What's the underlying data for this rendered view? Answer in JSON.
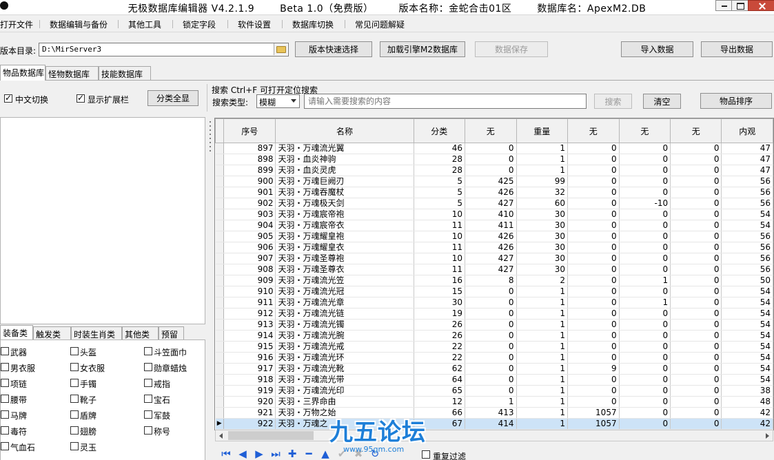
{
  "window": {
    "title_parts": [
      "无极数据库编辑器 V4.2.1.9",
      "Beta 1.0（免费版）",
      "版本名称：金蛇合击01区",
      "数据库名：ApexM2.DB"
    ]
  },
  "menu": [
    "打开文件",
    "数据编辑与备份",
    "其他工具",
    "锁定字段",
    "软件设置",
    "数据库切换",
    "常见问题解疑"
  ],
  "toolbar": {
    "dir_label": "版本目录:",
    "dir_value": "D:\\MirServer3",
    "quick_select": "版本快速选择",
    "load_engine": "加载引擎M2数据库",
    "save_data": "数据保存",
    "import_data": "导入数据",
    "export_data": "导出数据"
  },
  "tabs": [
    "物品数据库",
    "怪物数据库",
    "技能数据库"
  ],
  "options": {
    "chinese_switch": "中文切换",
    "show_ext": "显示扩展栏",
    "show_all_categories": "分类全显"
  },
  "search": {
    "hint": "搜索   Ctrl+F 可打开定位搜索",
    "type_label": "搜索类型:",
    "type_value": "模糊",
    "placeholder": "请输入需要搜索的内容",
    "search_button": "搜索",
    "clear_button": "清空",
    "sort_button": "物品排序"
  },
  "category_tabs": [
    "装备类",
    "触发类",
    "时装生肖类",
    "其他类",
    "预留"
  ],
  "categories": [
    [
      "武器",
      "头盔",
      "斗笠面巾"
    ],
    [
      "男衣服",
      "女衣服",
      "勋章蜡烛"
    ],
    [
      "项链",
      "手镯",
      "戒指"
    ],
    [
      "腰带",
      "靴子",
      "宝石"
    ],
    [
      "马牌",
      "盾牌",
      "军鼓"
    ],
    [
      "毒符",
      "翅膀",
      "称号"
    ],
    [
      "气血石",
      "灵玉",
      ""
    ]
  ],
  "grid": {
    "columns": [
      "序号",
      "名称",
      "分类",
      "无",
      "重量",
      "无",
      "无",
      "无",
      "内观"
    ],
    "rows": [
      [
        "897",
        "天羽・万魂流光翼",
        "46",
        "0",
        "1",
        "0",
        "0",
        "0",
        "47"
      ],
      [
        "898",
        "天羽・血炎神驹",
        "28",
        "0",
        "1",
        "0",
        "0",
        "0",
        "47"
      ],
      [
        "899",
        "天羽・血炎灵虎",
        "28",
        "0",
        "1",
        "0",
        "0",
        "0",
        "47"
      ],
      [
        "900",
        "天羽・万魂巨阙刃",
        "5",
        "425",
        "99",
        "0",
        "0",
        "0",
        "56"
      ],
      [
        "901",
        "天羽・万魂吞魔杖",
        "5",
        "426",
        "32",
        "0",
        "0",
        "0",
        "56"
      ],
      [
        "902",
        "天羽・万魂极天剑",
        "5",
        "427",
        "60",
        "0",
        "-10",
        "0",
        "56"
      ],
      [
        "903",
        "天羽・万魂宸帝袍",
        "10",
        "410",
        "30",
        "0",
        "0",
        "0",
        "54"
      ],
      [
        "904",
        "天羽・万魂宸帝衣",
        "11",
        "411",
        "30",
        "0",
        "0",
        "0",
        "54"
      ],
      [
        "905",
        "天羽・万魂耀皇袍",
        "10",
        "426",
        "30",
        "0",
        "0",
        "0",
        "56"
      ],
      [
        "906",
        "天羽・万魂耀皇衣",
        "11",
        "426",
        "30",
        "0",
        "0",
        "0",
        "56"
      ],
      [
        "907",
        "天羽・万魂圣尊袍",
        "10",
        "427",
        "30",
        "0",
        "0",
        "0",
        "56"
      ],
      [
        "908",
        "天羽・万魂圣尊衣",
        "11",
        "427",
        "30",
        "0",
        "0",
        "0",
        "56"
      ],
      [
        "909",
        "天羽・万魂流光笠",
        "16",
        "8",
        "2",
        "0",
        "1",
        "0",
        "50"
      ],
      [
        "910",
        "天羽・万魂流光冠",
        "15",
        "0",
        "1",
        "0",
        "0",
        "0",
        "54"
      ],
      [
        "911",
        "天羽・万魂流光章",
        "30",
        "0",
        "1",
        "0",
        "1",
        "0",
        "54"
      ],
      [
        "912",
        "天羽・万魂流光链",
        "19",
        "0",
        "1",
        "0",
        "0",
        "0",
        "54"
      ],
      [
        "913",
        "天羽・万魂流光镯",
        "26",
        "0",
        "1",
        "0",
        "0",
        "0",
        "54"
      ],
      [
        "914",
        "天羽・万魂流光腕",
        "26",
        "0",
        "1",
        "0",
        "0",
        "0",
        "54"
      ],
      [
        "915",
        "天羽・万魂流光戒",
        "22",
        "0",
        "1",
        "0",
        "0",
        "0",
        "54"
      ],
      [
        "916",
        "天羽・万魂流光环",
        "22",
        "0",
        "1",
        "0",
        "0",
        "0",
        "54"
      ],
      [
        "917",
        "天羽・万魂流光靴",
        "62",
        "0",
        "1",
        "9",
        "0",
        "0",
        "54"
      ],
      [
        "918",
        "天羽・万魂流光带",
        "64",
        "0",
        "1",
        "0",
        "0",
        "0",
        "54"
      ],
      [
        "919",
        "天羽・万魂流光印",
        "65",
        "0",
        "1",
        "0",
        "0",
        "0",
        "38"
      ],
      [
        "920",
        "天羽・三界命由",
        "12",
        "1",
        "1",
        "0",
        "0",
        "0",
        "48"
      ],
      [
        "921",
        "天羽・万物之始",
        "66",
        "413",
        "1",
        "1057",
        "0",
        "0",
        "42"
      ],
      [
        "922",
        "天羽・万魂之",
        "67",
        "414",
        "1",
        "1057",
        "0",
        "0",
        "42"
      ]
    ]
  },
  "navigator": {
    "filter_label": "重复过滤"
  },
  "watermark": {
    "brand": "九五论坛",
    "url": "www.95gm.com"
  },
  "colors": {
    "accent": "#1f5fd6",
    "selected_row": "#cde3f7",
    "close_button": "#c94a3a"
  }
}
